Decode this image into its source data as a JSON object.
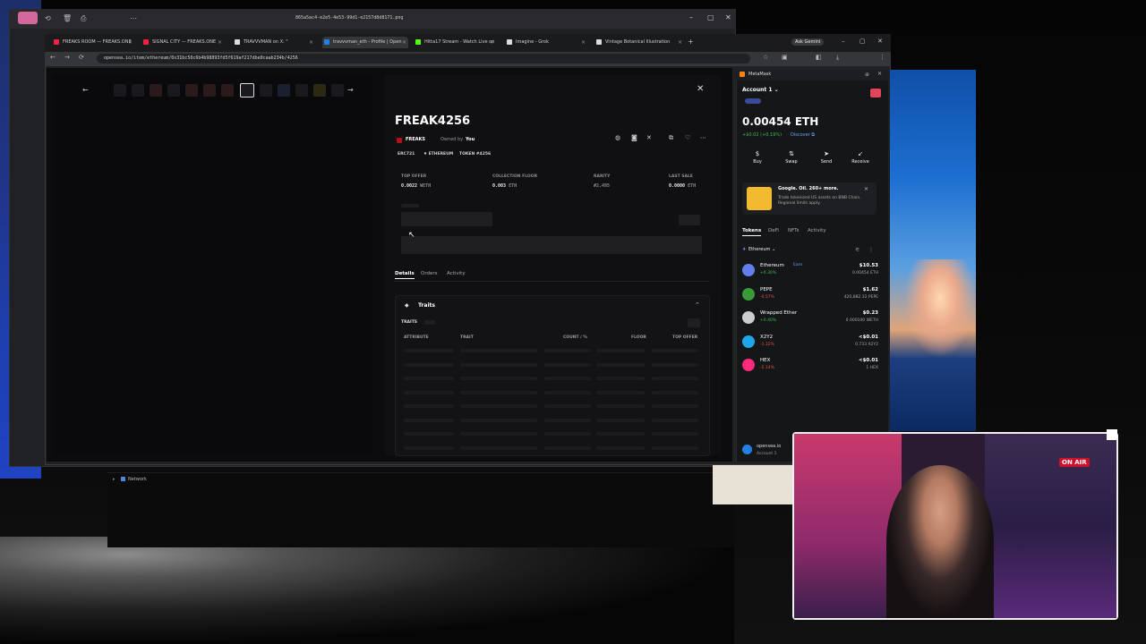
{
  "outer_window": {
    "title": "865a5ac4-e2e5-4e53-99d1-e2157d8d8171.png"
  },
  "browser": {
    "tabs": [
      {
        "label": "FREAKS ROOM — FREAKS.ONE",
        "color": "#e24"
      },
      {
        "label": "SIGNAL CITY — FREAKS.ONE",
        "color": "#e24"
      },
      {
        "label": "TRAVVVMAN on X: \"",
        "color": "#ddd"
      },
      {
        "label": "travvvman_eth - Profile | Open",
        "color": "#2081e2"
      },
      {
        "label": "Hitta17 Stream - Watch Live on",
        "color": "#53fc18"
      },
      {
        "label": "Imagine - Grok",
        "color": "#ddd"
      },
      {
        "label": "Vintage Botanical Illustration",
        "color": "#ddd"
      }
    ],
    "url": "opensea.io/item/ethereum/0x31bc50c6b4b98893fd5f619af217dbe0caab234b/4256",
    "ask_label": "Ask Gemini"
  },
  "nft": {
    "title": "FREAK4256",
    "collection": "FREAKS",
    "owned_by_prefix": "Owned by",
    "owner": "You",
    "chips": [
      "ERC721",
      "ETHEREUM",
      "TOKEN #4256"
    ],
    "stats": [
      {
        "label": "TOP OFFER",
        "value": "0.0022",
        "unit": "WETH"
      },
      {
        "label": "COLLECTION FLOOR",
        "value": "0.003",
        "unit": "ETH"
      },
      {
        "label": "RARITY",
        "value": "#2,495",
        "unit": ""
      },
      {
        "label": "LAST SALE",
        "value": "0.0000",
        "unit": "ETH"
      }
    ],
    "tabs": [
      "Details",
      "Orders",
      "Activity"
    ],
    "traits_header": "Traits",
    "traits_sublabel": "TRAITS",
    "trait_columns": [
      "ATTRIBUTE",
      "TRAIT",
      "COUNT / %",
      "FLOOR",
      "TOP OFFER"
    ]
  },
  "metamask": {
    "app": "MetaMask",
    "account": "Account 1",
    "balance": "0.00454 ETH",
    "change": "+$0.02 (+0.19%)",
    "discover": "Discover",
    "actions": [
      {
        "label": "Buy",
        "icon": "$"
      },
      {
        "label": "Swap",
        "icon": "⇅"
      },
      {
        "label": "Send",
        "icon": "➤"
      },
      {
        "label": "Receive",
        "icon": "↙"
      }
    ],
    "promo": {
      "title": "Google. Oil. 260+ more.",
      "text": "Trade tokenized US assets on BNB Chain. Regional limits apply."
    },
    "tabs": [
      "Tokens",
      "DeFi",
      "NFTs",
      "Activity"
    ],
    "network": "Ethereum",
    "tokens": [
      {
        "name": "Ethereum",
        "badge": "Earn",
        "change": "+0.30%",
        "fiat": "$10.53",
        "amount": "0.00454 ETH",
        "color": "#627eea",
        "up": true
      },
      {
        "name": "PEPE",
        "badge": "",
        "change": "-0.57%",
        "fiat": "$1.62",
        "amount": "420,882.32 PEPE",
        "color": "#3a9a3a",
        "up": false
      },
      {
        "name": "Wrapped Ether",
        "badge": "",
        "change": "+0.40%",
        "fiat": "$0.23",
        "amount": "0.000100 WETH",
        "color": "#cccccc",
        "up": true
      },
      {
        "name": "X2Y2",
        "badge": "",
        "change": "-1.12%",
        "fiat": "<$0.01",
        "amount": "0.733 X2Y2",
        "color": "#1ea7e8",
        "up": false
      },
      {
        "name": "HEX",
        "badge": "",
        "change": "-2.14%",
        "fiat": "<$0.01",
        "amount": "1 HEX",
        "color": "#ff2a7a",
        "up": false
      }
    ],
    "site": "opensea.io",
    "site_account": "Account 1"
  },
  "webcam": {
    "sign": "ON AIR"
  },
  "devtools": {
    "label": "Network"
  }
}
